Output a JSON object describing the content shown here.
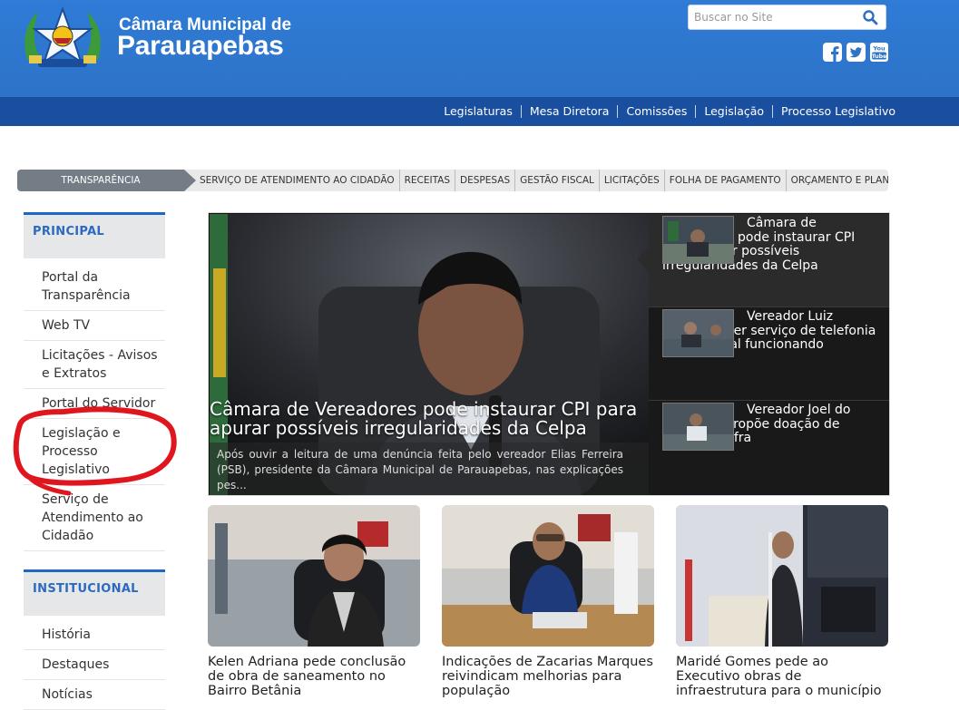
{
  "header": {
    "brand_line1": "Câmara Municipal de",
    "brand_line2": "Parauapebas",
    "search_placeholder": "Buscar no Site",
    "social": [
      "facebook-icon",
      "twitter-icon",
      "youtube-icon"
    ],
    "social_youtube_text": "You Tube"
  },
  "nav": [
    "Legislaturas",
    "Mesa Diretora",
    "Comissões",
    "Legislação",
    "Processo Legislativo"
  ],
  "transparency": {
    "label": "TRANSPARÊNCIA",
    "links": [
      "SERVIÇO DE ATENDIMENTO AO CIDADÃO",
      "RECEITAS",
      "DESPESAS",
      "GESTÃO FISCAL",
      "LICITAÇÕES",
      "FOLHA DE PAGAMENTO",
      "ORÇAMENTO E PLANEJAMENTO"
    ]
  },
  "sidebar": {
    "principal_title": "PRINCIPAL",
    "principal_items": [
      "Portal da Transparência",
      "Web TV",
      "Licitações - Avisos e Extratos",
      "Portal do Servidor",
      "Legislação e Processo Legislativo",
      "Serviço de Atendimento ao Cidadão"
    ],
    "institucional_title": "INSTITUCIONAL",
    "institucional_items": [
      "História",
      "Destaques",
      "Notícias"
    ]
  },
  "featured": {
    "title": "Câmara de Vereadores pode instaurar CPI para apurar possíveis irregularidades da Celpa",
    "summary": "Após ouvir a leitura de uma denúncia feita pelo vereador Elias Ferreira (PSB), presidente da Câmara Municipal de Parauapebas, nas explicações pes...",
    "items": [
      "Câmara de Vereadores pode instaurar CPI para apurar possíveis irregularidades da Celpa",
      "Vereador Luiz Castilho quer serviço de telefonia emergencial funcionando",
      "Vereador Joel do Sindicato propõe doação de terreno à Ufra"
    ]
  },
  "news": [
    "Kelen Adriana pede conclusão de obra de saneamento no Bairro Betânia",
    "Indicações de Zacarias Marques reivindicam melhorias para população",
    "Maridé Gomes pede ao Executivo obras de infraestrutura para o município"
  ],
  "colors": {
    "header_blue": "#2d73c8",
    "nav_blue": "#1a4fa0",
    "accent_blue": "#1f67c4",
    "annotation_red": "#e0161f"
  }
}
